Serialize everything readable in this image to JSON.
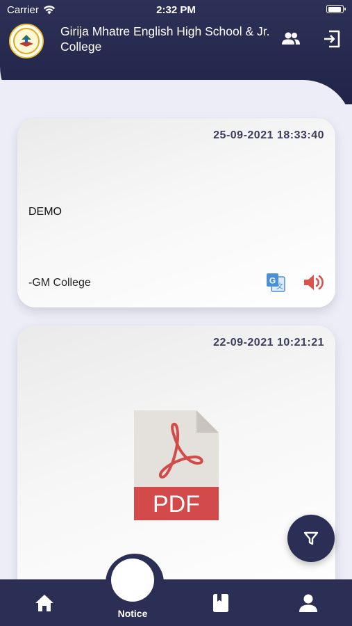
{
  "status_bar": {
    "carrier": "Carrier",
    "time": "2:32 PM"
  },
  "header": {
    "title": "Girija Mhatre English High School & Jr. College"
  },
  "notices": [
    {
      "datetime": "25-09-2021 18:33:40",
      "body": "DEMO",
      "signature": "-GM College"
    },
    {
      "datetime": "22-09-2021 10:21:21",
      "attachment_label": "PDF"
    }
  ],
  "bottom_nav": {
    "active_label": "Notice"
  },
  "colors": {
    "primary": "#2b2e55",
    "accent_red": "#d9534f",
    "translate_blue": "#4a90d9"
  }
}
